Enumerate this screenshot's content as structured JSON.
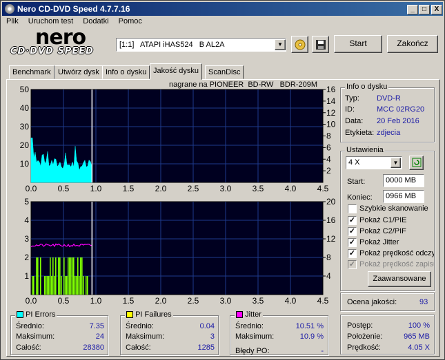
{
  "window": {
    "title": "Nero CD-DVD Speed 4.7.7.16",
    "min": "_",
    "max": "□",
    "close": "X"
  },
  "menu": [
    "Plik",
    "Uruchom test",
    "Dodatki",
    "Pomoc"
  ],
  "logo": {
    "top": "nero",
    "bottom": "CD·DVD SPEED"
  },
  "drive": {
    "value": "[1:1]   ATAPI iHAS524   B AL2A"
  },
  "buttons": {
    "start": "Start",
    "end": "Zakończ",
    "advanced": "Zaawansowane"
  },
  "tabs": [
    "Benchmark",
    "Utwórz dysk",
    "Info o dysku",
    "Jakość dysku",
    "ScanDisc"
  ],
  "recorded_on": "nagrane na PIONEER  BD-RW   BDR-209M",
  "disc_info": {
    "title": "Info o dysku",
    "rows": [
      {
        "label": "Typ:",
        "value": "DVD-R"
      },
      {
        "label": "ID:",
        "value": "MCC 02RG20"
      },
      {
        "label": "Data:",
        "value": "20 Feb 2016"
      },
      {
        "label": "Etykieta:",
        "value": "zdjecia"
      }
    ]
  },
  "settings": {
    "title": "Ustawienia",
    "speed": "4 X",
    "start_label": "Start:",
    "start_value": "0000 MB",
    "end_label": "Koniec:",
    "end_value": "0966 MB",
    "checks": [
      {
        "label": "Szybkie skanowanie",
        "checked": false,
        "disabled": false
      },
      {
        "label": "Pokaż C1/PIE",
        "checked": true,
        "disabled": false
      },
      {
        "label": "Pokaż C2/PIF",
        "checked": true,
        "disabled": false
      },
      {
        "label": "Pokaż Jitter",
        "checked": true,
        "disabled": false
      },
      {
        "label": "Pokaż prędkość odczytu",
        "checked": true,
        "disabled": false
      },
      {
        "label": "Pokaż prędkość zapisu",
        "checked": true,
        "disabled": true
      }
    ]
  },
  "quality": {
    "label": "Ocena jakości:",
    "value": "93"
  },
  "progress": {
    "rows": [
      {
        "label": "Postęp:",
        "value": "100 %"
      },
      {
        "label": "Położenie:",
        "value": "965 MB"
      },
      {
        "label": "Prędkość:",
        "value": "4.05 X"
      }
    ]
  },
  "pi_errors": {
    "title": "PI Errors",
    "color": "#00ffff",
    "rows": [
      {
        "label": "Średnio:",
        "value": "7.35"
      },
      {
        "label": "Maksimum:",
        "value": "24"
      },
      {
        "label": "Całość:",
        "value": "28380"
      }
    ]
  },
  "pi_failures": {
    "title": "PI Failures",
    "color": "#ffff00",
    "rows": [
      {
        "label": "Średnio:",
        "value": "0.04"
      },
      {
        "label": "Maksimum:",
        "value": "3"
      },
      {
        "label": "Całość:",
        "value": "1285"
      }
    ]
  },
  "jitter": {
    "title": "Jitter",
    "color": "#ff00ff",
    "rows": [
      {
        "label": "Średnio:",
        "value": "10.51 %"
      },
      {
        "label": "Maksimum:",
        "value": "10.9 %"
      },
      {
        "label": "Błędy PO:",
        "value": "-"
      }
    ]
  },
  "chart_data": [
    {
      "type": "area",
      "title": "nagrane na PIONEER  BD-RW   BDR-209M",
      "x_ticks": [
        "0.0",
        "0.5",
        "1.0",
        "1.5",
        "2.0",
        "2.5",
        "3.0",
        "3.5",
        "4.0",
        "4.5"
      ],
      "y_left_ticks": [
        "10",
        "20",
        "30",
        "40",
        "50"
      ],
      "y_right_ticks": [
        "2",
        "4",
        "6",
        "8",
        "10",
        "12",
        "14",
        "16"
      ],
      "xlim": [
        0,
        4.5
      ],
      "ylim": [
        0,
        50
      ],
      "y2lim": [
        0,
        16
      ],
      "series": [
        {
          "name": "PI Errors",
          "color": "#00ffff",
          "x_end": 0.94,
          "approx_level": 11,
          "max": 24
        },
        {
          "color": "#ffffff",
          "kind": "marker",
          "x": 0.94
        }
      ]
    },
    {
      "type": "bar",
      "x_ticks": [
        "0.0",
        "0.5",
        "1.0",
        "1.5",
        "2.0",
        "2.5",
        "3.0",
        "3.5",
        "4.0",
        "4.5"
      ],
      "y_left_ticks": [
        "1",
        "2",
        "3",
        "4",
        "5"
      ],
      "y_right_ticks": [
        "4",
        "8",
        "12",
        "16",
        "20"
      ],
      "xlim": [
        0,
        4.5
      ],
      "ylim": [
        0,
        5
      ],
      "y2lim": [
        0,
        20
      ],
      "series": [
        {
          "name": "PI Failures",
          "color": "#7fff00",
          "x_end": 0.94,
          "max": 3
        },
        {
          "name": "Jitter",
          "color": "#ff00ff",
          "x_end": 0.94,
          "approx_level": 10.6
        }
      ]
    }
  ]
}
